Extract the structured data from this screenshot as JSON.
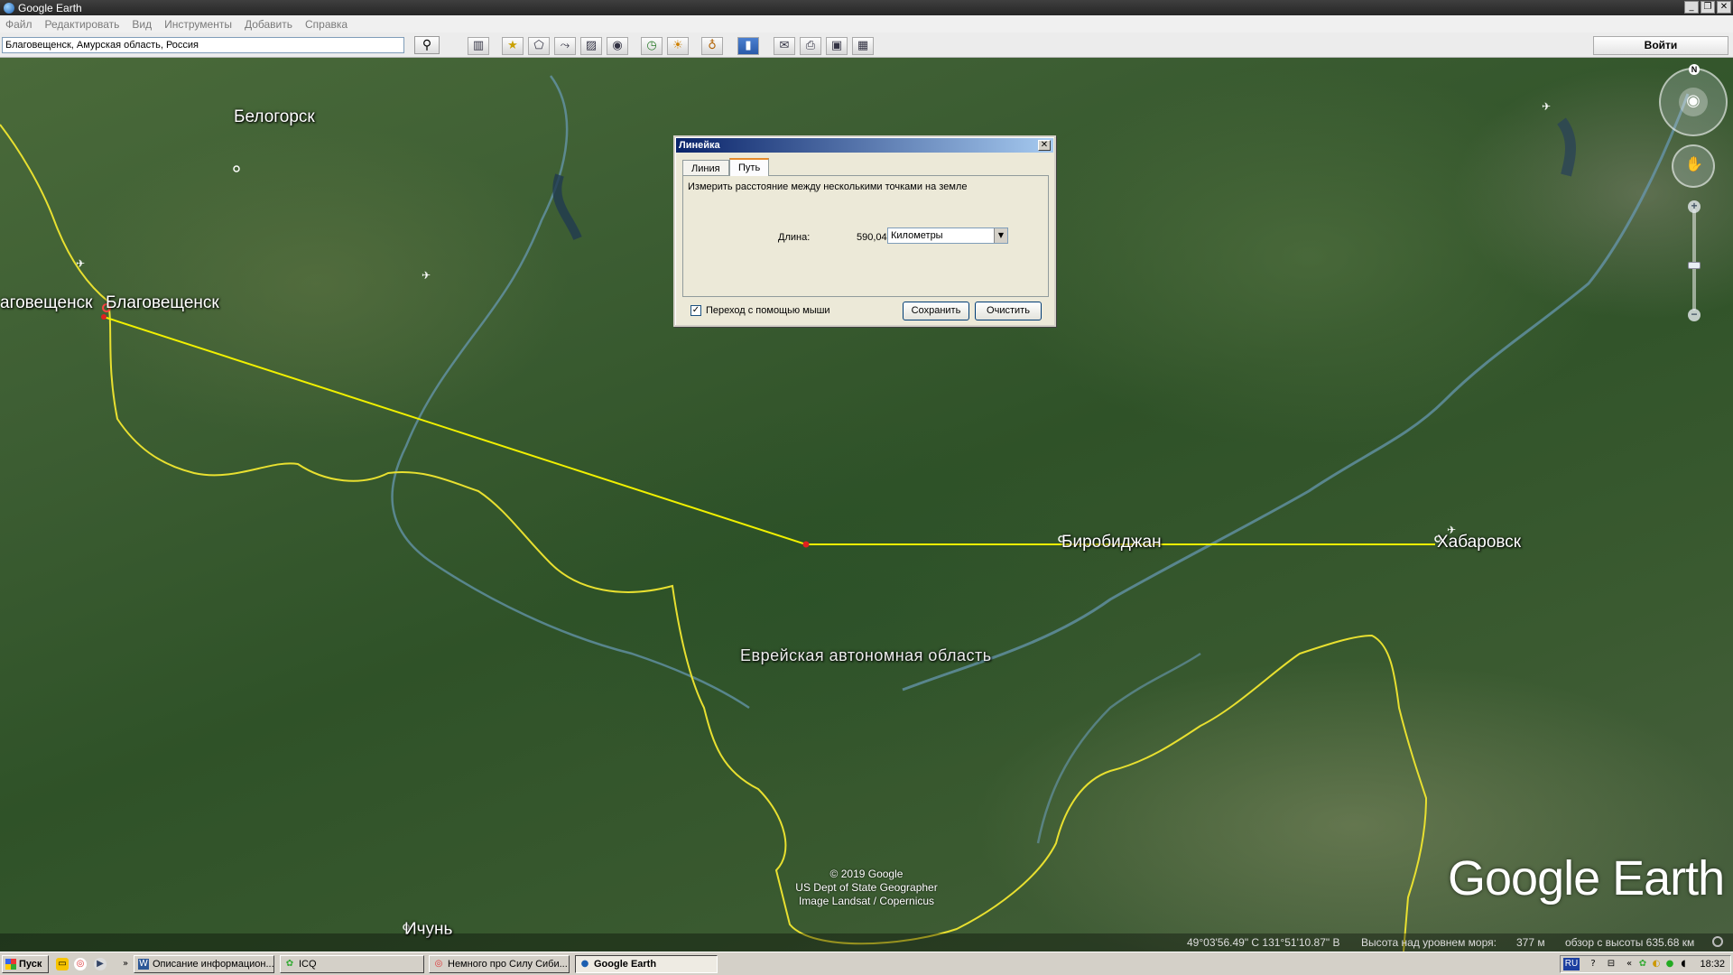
{
  "window": {
    "title": "Google Earth",
    "buttons": [
      "_",
      "❐",
      "✕"
    ]
  },
  "menu": [
    "Файл",
    "Редактировать",
    "Вид",
    "Инструменты",
    "Добавить",
    "Справка"
  ],
  "search": {
    "value": "Благовещенск, Амурская область, Россия",
    "button_icon": "search-icon"
  },
  "toolbar": {
    "icons": [
      "sidebar-icon",
      "placemark-icon",
      "polygon-icon",
      "path-icon",
      "overlay-icon",
      "record-tour-icon",
      "historical-imagery-icon",
      "sunlight-icon",
      "planets-icon",
      "ruler-icon",
      "email-icon",
      "print-icon",
      "save-image-icon",
      "view-in-maps-icon"
    ],
    "signin_label": "Войти"
  },
  "map": {
    "places": {
      "belogorsk": "Белогорск",
      "blag1": "аговещенск",
      "blag2": "Благовещенск",
      "birobidzhan": "Биробиджан",
      "khabarovsk": "Хабаровск",
      "ichun": "Ичунь"
    },
    "region": "Еврейская автономная область",
    "copyright": [
      "© 2019 Google",
      "US Dept of State Geographer",
      "Image Landsat / Copernicus"
    ],
    "watermark": "Google Earth",
    "colors": {
      "border": "#e8e030",
      "ruler_line": "#f0f000",
      "point": "#e02020"
    }
  },
  "nav": {
    "north": "N",
    "zoom_in": "+",
    "zoom_out": "−",
    "zoom_level": 0.45
  },
  "statusbar": {
    "coords": "49°03'56.49\" С   131°51'10.87\" В",
    "elevation_label": "Высота над уровнем моря:",
    "elevation_value": "377 м",
    "eye_alt": "обзор с высоты 635.68 км"
  },
  "ruler": {
    "title": "Линейка",
    "tabs": [
      "Линия",
      "Путь"
    ],
    "active_tab": "Путь",
    "description": "Измерить расстояние между несколькими точками на земле",
    "length_label": "Длина:",
    "length_value": "590,04",
    "unit": "Километры",
    "mouse_nav_label": "Переход с помощью мыши",
    "mouse_nav_checked": true,
    "save_label": "Сохранить",
    "clear_label": "Очистить"
  },
  "taskbar": {
    "start_label": "Пуск",
    "tasks": [
      "Описание информацион...",
      "ICQ",
      "Немного про Силу Сиби...",
      "Google Earth"
    ],
    "lang": "RU",
    "clock": "18:32"
  }
}
